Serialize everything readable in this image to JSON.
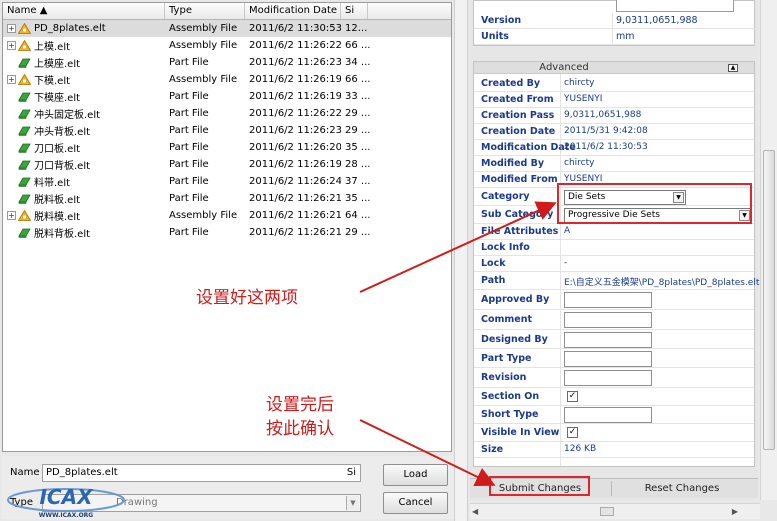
{
  "file_list": {
    "columns": {
      "name": "Name",
      "type": "Type",
      "date": "Modification Date",
      "size": "Si"
    },
    "rows": [
      {
        "name": "PD_8plates.elt",
        "type": "Assembly File",
        "date": "2011/6/2 11:30:53",
        "size": "12...",
        "kind": "assembly",
        "expand": "+"
      },
      {
        "name": "上模.elt",
        "type": "Assembly File",
        "date": "2011/6/2 11:26:22",
        "size": "66 ...",
        "kind": "assembly",
        "expand": "+"
      },
      {
        "name": "上模座.elt",
        "type": "Part File",
        "date": "2011/6/2 11:26:23",
        "size": "34 ...",
        "kind": "part",
        "expand": ""
      },
      {
        "name": "下模.elt",
        "type": "Assembly File",
        "date": "2011/6/2 11:26:19",
        "size": "66 ...",
        "kind": "assembly",
        "expand": "+"
      },
      {
        "name": "下模座.elt",
        "type": "Part File",
        "date": "2011/6/2 11:26:19",
        "size": "33 ...",
        "kind": "part",
        "expand": ""
      },
      {
        "name": "冲头固定板.elt",
        "type": "Part File",
        "date": "2011/6/2 11:26:22",
        "size": "29 ...",
        "kind": "part",
        "expand": ""
      },
      {
        "name": "冲头背板.elt",
        "type": "Part File",
        "date": "2011/6/2 11:26:23",
        "size": "29 ...",
        "kind": "part",
        "expand": ""
      },
      {
        "name": "刀口板.elt",
        "type": "Part File",
        "date": "2011/6/2 11:26:20",
        "size": "35 ...",
        "kind": "part",
        "expand": ""
      },
      {
        "name": "刀口背板.elt",
        "type": "Part File",
        "date": "2011/6/2 11:26:19",
        "size": "28 ...",
        "kind": "part",
        "expand": ""
      },
      {
        "name": "料带.elt",
        "type": "Part File",
        "date": "2011/6/2 11:26:24",
        "size": "37 ...",
        "kind": "part",
        "expand": ""
      },
      {
        "name": "脱料板.elt",
        "type": "Part File",
        "date": "2011/6/2 11:26:21",
        "size": "35 ...",
        "kind": "part",
        "expand": ""
      },
      {
        "name": "脱料模.elt",
        "type": "Assembly File",
        "date": "2011/6/2 11:26:21",
        "size": "64 ...",
        "kind": "assembly",
        "expand": "+"
      },
      {
        "name": "脱料背板.elt",
        "type": "Part File",
        "date": "2011/6/2 11:26:21",
        "size": "29 ...",
        "kind": "part",
        "expand": ""
      }
    ]
  },
  "bottom": {
    "name_label": "Name",
    "name_value": "PD_8plates.elt",
    "name_suffix": "Si",
    "type_label": "Type",
    "type_value": "Drawing",
    "load_label": "Load",
    "cancel_label": "Cancel"
  },
  "logo": {
    "main": "ICAX",
    "sub": "WWW.ICAX.ORG"
  },
  "properties_top": [
    {
      "key": "Version",
      "value": "9,0311,0651,988"
    },
    {
      "key": "Units",
      "value": "mm"
    }
  ],
  "advanced": {
    "title": "Advanced",
    "rows": [
      {
        "key": "Created By",
        "value": "chircty",
        "kind": "text"
      },
      {
        "key": "Created From",
        "value": "YUSENYI",
        "kind": "text"
      },
      {
        "key": "Creation Pass",
        "value": "9,0311,0651,988",
        "kind": "text"
      },
      {
        "key": "Creation Date",
        "value": "2011/5/31 9:42:08",
        "kind": "text"
      },
      {
        "key": "Modification Date",
        "value": "2011/6/2 11:30:53",
        "kind": "text"
      },
      {
        "key": "Modified By",
        "value": "chircty",
        "kind": "text"
      },
      {
        "key": "Modified From",
        "value": "YUSENYI",
        "kind": "text"
      },
      {
        "key": "Category",
        "value": "Die Sets",
        "kind": "combo"
      },
      {
        "key": "Sub Category",
        "value": "Progressive Die Sets",
        "kind": "combo"
      },
      {
        "key": "File Attributes",
        "value": "A",
        "kind": "text"
      },
      {
        "key": "Lock Info",
        "value": "",
        "kind": "text"
      },
      {
        "key": "Lock",
        "value": "-",
        "kind": "text"
      },
      {
        "key": "Path",
        "value": "E:\\自定义五金模架\\PD_8plates\\PD_8plates.elt",
        "kind": "text"
      },
      {
        "key": "Approved By",
        "value": "",
        "kind": "input"
      },
      {
        "key": "Comment",
        "value": "",
        "kind": "input"
      },
      {
        "key": "Designed By",
        "value": "",
        "kind": "input"
      },
      {
        "key": "Part Type",
        "value": "",
        "kind": "input"
      },
      {
        "key": "Revision",
        "value": "",
        "kind": "input"
      },
      {
        "key": "Section On",
        "value": "✓",
        "kind": "check"
      },
      {
        "key": "Short Type",
        "value": "",
        "kind": "input"
      },
      {
        "key": "Visible In View",
        "value": "✓",
        "kind": "check"
      },
      {
        "key": "Size",
        "value": "126 KB",
        "kind": "text"
      }
    ]
  },
  "actions": {
    "submit": "Submit Changes",
    "reset": "Reset Changes"
  },
  "annotations": {
    "set_two": "设置好这两项",
    "after_line1": "设置完后",
    "after_line2": "按此确认"
  },
  "colors": {
    "annotation": "#e0262c",
    "key_text": "#1a3a8a"
  }
}
